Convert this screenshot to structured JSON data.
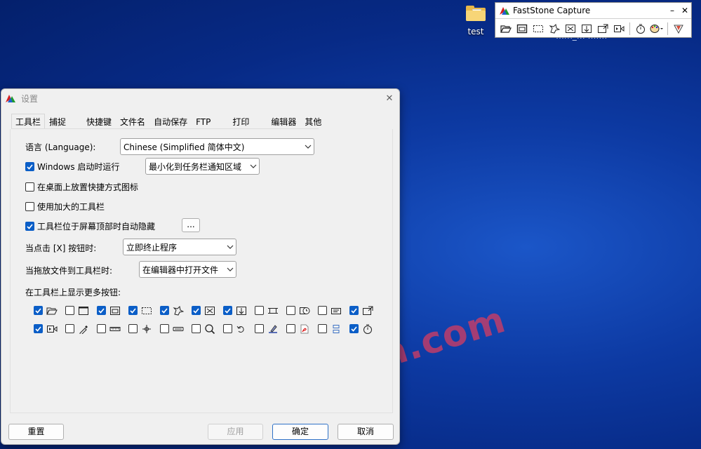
{
  "desktop": {
    "icon_label": "test",
    "background_text": "…m_… ….…"
  },
  "faststone": {
    "title": "FastStone Capture",
    "min_symbol": "–",
    "close_symbol": "✕"
  },
  "watermark": "wklan.com",
  "dialog": {
    "title": "设置",
    "close_symbol": "✕",
    "tabs": [
      "工具栏",
      "捕捉",
      "快捷键",
      "文件名",
      "自动保存",
      "FTP",
      "打印",
      "编辑器",
      "其他"
    ],
    "active_tab": "工具栏",
    "language_label": "语言 (Language):",
    "language_value": "Chinese (Simplified 简体中文)",
    "windows_startup_label": "Windows 启动时运行",
    "windows_startup_checked": true,
    "startup_mode_value": "最小化到任务栏通知区域",
    "desktop_shortcut_label": "在桌面上放置快捷方式图标",
    "desktop_shortcut_checked": false,
    "large_toolbar_label": "使用加大的工具栏",
    "large_toolbar_checked": false,
    "autohide_label": "工具栏位于屏幕顶部时自动隐藏",
    "autohide_checked": true,
    "autohide_more": "...",
    "close_click_label": "当点击 [X] 按钮时:",
    "close_click_value": "立即终止程序",
    "drag_file_label": "当拖放文件到工具栏时:",
    "drag_file_value": "在编辑器中打开文件",
    "more_buttons_label": "在工具栏上显示更多按钮:",
    "more_buttons": [
      {
        "icon": "open-folder-icon",
        "checked": true
      },
      {
        "icon": "active-window-icon",
        "checked": false
      },
      {
        "icon": "window-object-icon",
        "checked": true
      },
      {
        "icon": "rectangle-region-icon",
        "checked": true
      },
      {
        "icon": "freehand-region-icon",
        "checked": true
      },
      {
        "icon": "fullscreen-icon",
        "checked": true
      },
      {
        "icon": "scrolling-window-icon",
        "checked": true
      },
      {
        "icon": "fixed-region-icon",
        "checked": false
      },
      {
        "icon": "delay-capture-icon",
        "checked": false
      },
      {
        "icon": "output-icon",
        "checked": false
      },
      {
        "icon": "send-to-icon",
        "checked": true
      },
      {
        "icon": "screen-recorder-icon",
        "checked": true
      },
      {
        "icon": "color-picker-icon",
        "checked": false
      },
      {
        "icon": "screen-ruler-icon",
        "checked": false
      },
      {
        "icon": "crosshair-icon",
        "checked": false
      },
      {
        "icon": "screen-pen-icon",
        "checked": false
      },
      {
        "icon": "magnifier-icon",
        "checked": false
      },
      {
        "icon": "undo-icon",
        "checked": false
      },
      {
        "icon": "screen-pen-drawing-icon",
        "checked": false
      },
      {
        "icon": "pdf-icon",
        "checked": false
      },
      {
        "icon": "join-images-icon",
        "checked": false
      },
      {
        "icon": "timer-icon",
        "checked": true
      }
    ],
    "buttons": {
      "reset": "重置",
      "apply": "应用",
      "ok": "确定",
      "cancel": "取消"
    }
  },
  "colors": {
    "checkbox_accent": "#0b5ec7",
    "dialog_bg": "#f0f0f0",
    "watermark": "#ce3c64"
  }
}
